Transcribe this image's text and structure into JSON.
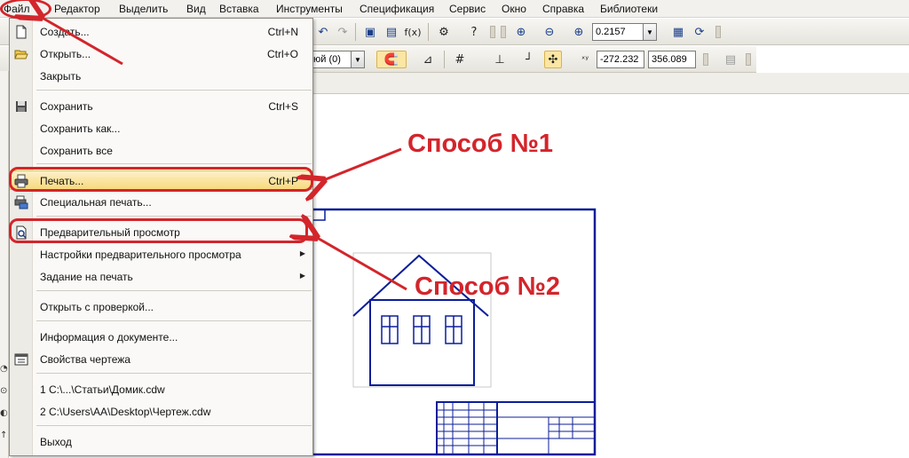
{
  "menubar": {
    "items": [
      "Файл",
      "Редактор",
      "Выделить",
      "Вид",
      "Вставка",
      "Инструменты",
      "Спецификация",
      "Сервис",
      "Окно",
      "Справка",
      "Библиотеки"
    ]
  },
  "toolbar": {
    "zoom_value": "0.2157",
    "layer_value": "юй (0)",
    "coord_x": "-272.232",
    "coord_y": "356.089"
  },
  "file_menu": {
    "items": [
      {
        "label": "Создать...",
        "shortcut": "Ctrl+N",
        "icon": "new-document-icon"
      },
      {
        "label": "Открыть...",
        "shortcut": "Ctrl+O",
        "icon": "open-folder-icon"
      },
      {
        "label": "Закрыть",
        "shortcut": "",
        "icon": ""
      },
      {
        "label": "Сохранить",
        "shortcut": "Ctrl+S",
        "icon": "floppy-disk-icon"
      },
      {
        "label": "Сохранить как...",
        "shortcut": "",
        "icon": ""
      },
      {
        "label": "Сохранить все",
        "shortcut": "",
        "icon": ""
      },
      {
        "label": "Печать...",
        "shortcut": "Ctrl+P",
        "icon": "printer-icon"
      },
      {
        "label": "Специальная печать...",
        "shortcut": "",
        "icon": "special-print-icon"
      },
      {
        "label": "Предварительный просмотр",
        "shortcut": "",
        "icon": "print-preview-icon"
      },
      {
        "label": "Настройки предварительного просмотра",
        "shortcut": "",
        "icon": ""
      },
      {
        "label": "Задание на печать",
        "shortcut": "",
        "icon": ""
      },
      {
        "label": "Открыть с проверкой...",
        "shortcut": "",
        "icon": ""
      },
      {
        "label": "Информация о документе...",
        "shortcut": "",
        "icon": ""
      },
      {
        "label": "Свойства чертежа",
        "shortcut": "",
        "icon": "drawing-properties-icon"
      },
      {
        "label": "1 C:\\...\\Статьи\\Домик.cdw",
        "shortcut": "",
        "icon": ""
      },
      {
        "label": "2 C:\\Users\\AA\\Desktop\\Чертеж.cdw",
        "shortcut": "",
        "icon": ""
      },
      {
        "label": "Выход",
        "shortcut": "",
        "icon": ""
      }
    ]
  },
  "annotations": {
    "method1": "Способ №1",
    "method2": "Способ №2"
  },
  "colors": {
    "accent_red": "#d3252b",
    "drawing_blue": "#0b1e9a",
    "highlight": "#f8d97e"
  }
}
